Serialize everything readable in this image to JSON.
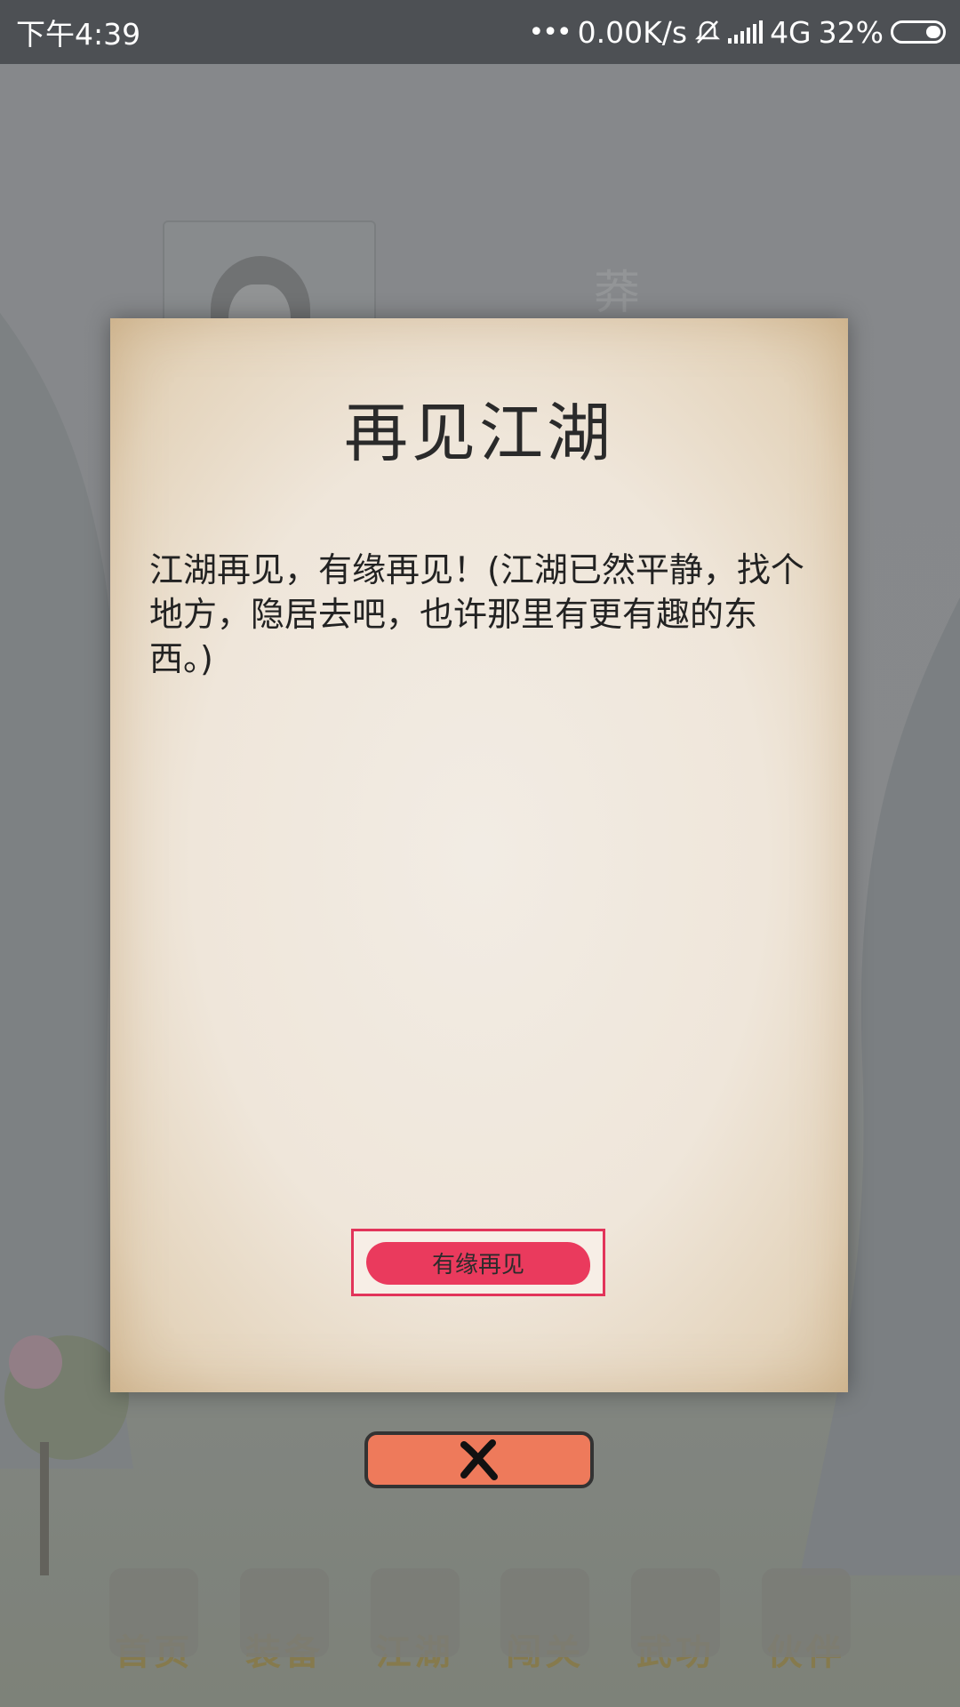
{
  "status_bar": {
    "time": "下午4:39",
    "network_speed": "0.00K/s",
    "network_type": "4G",
    "battery": "32%"
  },
  "background": {
    "grave_character": "莽"
  },
  "dialog": {
    "title": "再见江湖",
    "body": "江湖再见，有缘再见！(江湖已然平静，找个地方，隐居去吧，也许那里有更有趣的东西。)",
    "confirm_label": "有缘再见"
  },
  "close_button": {
    "icon": "close-icon"
  },
  "bottom_nav": {
    "items": [
      {
        "label": "首页",
        "icon": "home-icon"
      },
      {
        "label": "装备",
        "icon": "armor-icon"
      },
      {
        "label": "江湖",
        "icon": "jianghu-icon"
      },
      {
        "label": "闯关",
        "icon": "swords-icon"
      },
      {
        "label": "武功",
        "icon": "book-icon"
      },
      {
        "label": "伙伴",
        "icon": "partners-icon"
      }
    ]
  },
  "colors": {
    "confirm_accent": "#ea3a5d",
    "close_button": "#ee7a5b",
    "status_bar": "#4d5054"
  }
}
